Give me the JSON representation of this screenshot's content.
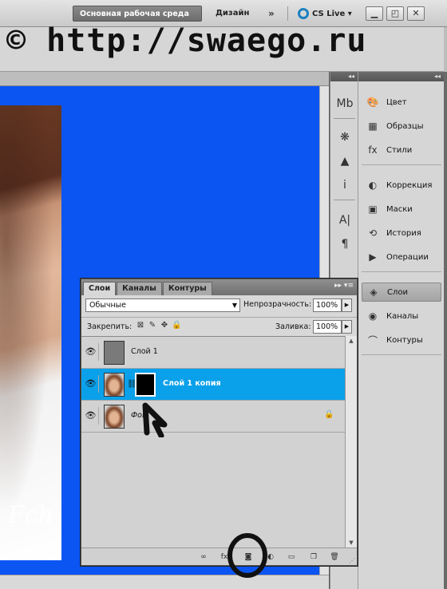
{
  "topbar": {
    "workspace_main": "Основная рабочая среда",
    "workspace_design": "Дизайн",
    "more": "»",
    "cs_live": "CS Live ▾",
    "window_controls": [
      "▁",
      "◰",
      "✕"
    ]
  },
  "watermark": "© http://swaego.ru",
  "canvas": {
    "background_color": "#0b55f3",
    "signature": "Fch"
  },
  "dock_icons": [
    {
      "name": "mini-bridge-icon",
      "glyph": "Mb"
    },
    {
      "name": "brush-presets-icon",
      "glyph": "❋"
    },
    {
      "name": "histogram-icon",
      "glyph": "▲"
    },
    {
      "name": "info-icon",
      "glyph": "i"
    },
    {
      "name": "character-icon",
      "glyph": "A|"
    },
    {
      "name": "paragraph-icon",
      "glyph": "¶"
    }
  ],
  "dock_panels": [
    {
      "label": "Цвет",
      "icon": "color-icon",
      "glyph": "🎨"
    },
    {
      "label": "Образцы",
      "icon": "swatches-icon",
      "glyph": "▦"
    },
    {
      "label": "Стили",
      "icon": "styles-icon",
      "glyph": "fx"
    },
    {
      "label": "Коррекция",
      "icon": "adjustments-icon",
      "glyph": "◐"
    },
    {
      "label": "Маски",
      "icon": "masks-icon",
      "glyph": "▣"
    },
    {
      "label": "История",
      "icon": "history-icon",
      "glyph": "⟲"
    },
    {
      "label": "Операции",
      "icon": "actions-icon",
      "glyph": "▶"
    },
    {
      "label": "Слои",
      "icon": "layers-icon",
      "glyph": "◈",
      "active": true
    },
    {
      "label": "Каналы",
      "icon": "channels-icon",
      "glyph": "◉"
    },
    {
      "label": "Контуры",
      "icon": "paths-icon",
      "glyph": "⌒"
    }
  ],
  "layers_panel": {
    "tabs": [
      "Слои",
      "Каналы",
      "Контуры"
    ],
    "menu_buttons": "▸▸ ▾≡",
    "blend_mode": "Обычные",
    "opacity_label": "Непрозрачность:",
    "opacity_value": "100%",
    "lock_label": "Закрепить:",
    "fill_label": "Заливка:",
    "fill_value": "100%",
    "layers": [
      {
        "name": "Слой 1",
        "thumb": "gray",
        "selected": false,
        "mask": false,
        "locked": false,
        "italic": false
      },
      {
        "name": "Слой 1 копия",
        "thumb": "face",
        "selected": true,
        "mask": true,
        "locked": false,
        "italic": false
      },
      {
        "name": "Фон",
        "thumb": "face",
        "selected": false,
        "mask": false,
        "locked": true,
        "italic": true
      }
    ],
    "footer_icons": [
      "link-layers-icon",
      "fx-icon",
      "add-mask-icon",
      "adjustment-layer-icon",
      "group-icon",
      "new-layer-icon",
      "delete-icon"
    ]
  }
}
